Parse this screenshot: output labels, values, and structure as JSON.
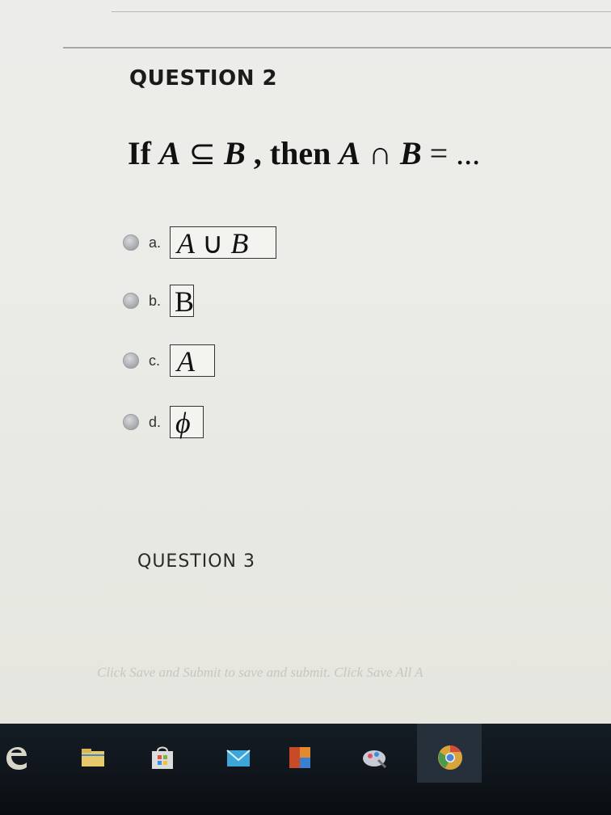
{
  "question2": {
    "label": "QUESTION 2",
    "prefix": "If ",
    "set_a": "A",
    "subset_symbol": " ⊆ ",
    "set_b": "B",
    "then_text": " , then ",
    "set_a2": "A",
    "intersect_symbol": " ∩ ",
    "set_b2": "B",
    "equals_text": " = ...",
    "options": [
      {
        "letter": "a.",
        "left": "A",
        "op": " ∪ ",
        "right": "B"
      },
      {
        "letter": "b.",
        "value": "B"
      },
      {
        "letter": "c.",
        "value": "A"
      },
      {
        "letter": "d.",
        "value": "ϕ"
      }
    ]
  },
  "question3": {
    "label": "QUESTION 3"
  },
  "footer": {
    "note": "Click Save and Submit to save and submit. Click Save All A"
  },
  "taskbar": {
    "icons": [
      "edge-icon",
      "file-explorer-icon",
      "store-icon",
      "mail-icon",
      "office-icon",
      "paint-icon",
      "chrome-icon"
    ]
  },
  "colors": {
    "page_bg": "#ebebe7",
    "taskbar_bg": "#10161c",
    "radio": "#a4a7ab"
  }
}
